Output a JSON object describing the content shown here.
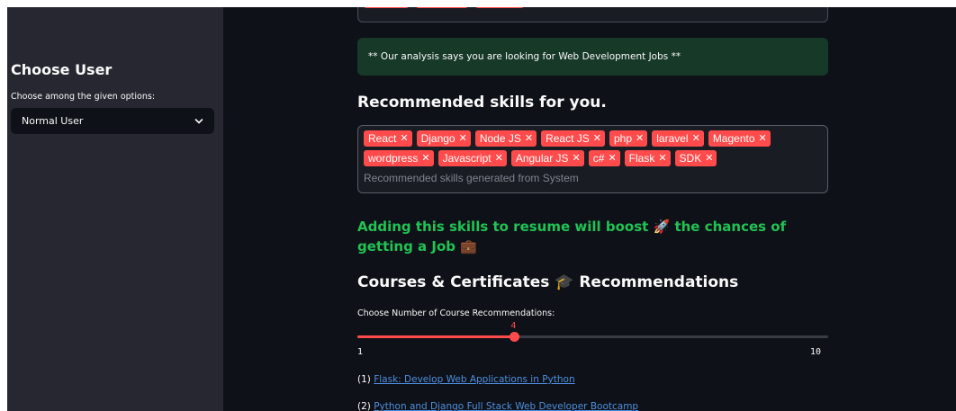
{
  "sidebar": {
    "title": "Choose User",
    "label": "Choose among the given options:",
    "selected": "Normal User"
  },
  "main": {
    "alert": "** Our analysis says you are looking for Web Development Jobs **",
    "skills_heading": "Recommended skills for you.",
    "skills": [
      "React",
      "Django",
      "Node JS",
      "React JS",
      "php",
      "laravel",
      "Magento",
      "wordpress",
      "Javascript",
      "Angular JS",
      "c#",
      "Flask",
      "SDK"
    ],
    "skills_placeholder": "Recommended skills generated from System",
    "boost_text": "Adding this skills to resume will boost 🚀 the chances of getting a Job 💼",
    "courses_heading": "Courses & Certificates 🎓 Recommendations",
    "slider": {
      "label": "Choose Number of Course Recommendations:",
      "min": 1,
      "max": 10,
      "value": 4
    },
    "courses": [
      {
        "index": "(1)",
        "title": "Flask: Develop Web Applications in Python"
      },
      {
        "index": "(2)",
        "title": "Python and Django Full Stack Web Developer Bootcamp"
      }
    ]
  },
  "colors": {
    "accent": "#ff4b4b",
    "success": "#21c354",
    "link": "#4e8fe0",
    "background": "#0e1117",
    "sidebar": "#262730"
  }
}
